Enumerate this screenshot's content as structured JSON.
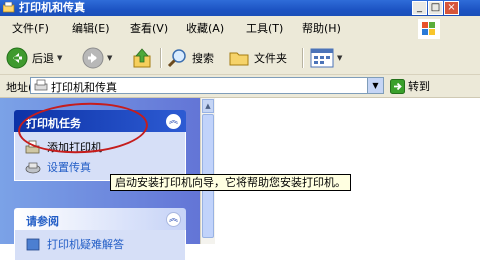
{
  "window": {
    "title": "打印机和传真"
  },
  "menu": [
    "文件(F)",
    "编辑(E)",
    "查看(V)",
    "收藏(A)",
    "工具(T)",
    "帮助(H)"
  ],
  "toolbar": {
    "back": "后退",
    "search": "搜索",
    "folders": "文件夹"
  },
  "address": {
    "label": "地址(D)",
    "value": "打印机和传真",
    "go": "转到"
  },
  "tasks_panel": {
    "title": "打印机任务",
    "items": [
      "添加打印机",
      "设置传真"
    ]
  },
  "see_also_panel": {
    "title": "请参阅",
    "items": [
      "打印机疑难解答"
    ]
  },
  "tooltip": "启动安装打印机向导，它将帮助您安装打印机。",
  "colors": {
    "titlebar": "#1d54c4",
    "pane": "#6f8de0",
    "annotation": "#c51d1d"
  }
}
